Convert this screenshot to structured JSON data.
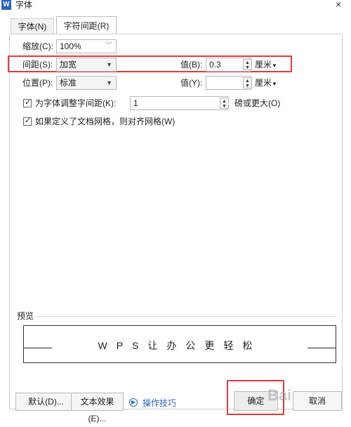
{
  "window": {
    "title": "字体",
    "app_icon": "W",
    "close_glyph": "×"
  },
  "tabs": [
    {
      "label": "字体(N)",
      "active": false
    },
    {
      "label": "字符间距(R)",
      "active": true
    }
  ],
  "form": {
    "scale_label": "缩放(C):",
    "scale_value": "100%",
    "spacing_label": "间距(S):",
    "spacing_value": "加宽",
    "spacing_amount_label": "值(B):",
    "spacing_amount_value": "0.3",
    "spacing_unit": "厘米",
    "position_label": "位置(P):",
    "position_value": "标准",
    "position_amount_label": "值(Y):",
    "position_amount_value": "",
    "position_unit": "厘米",
    "kerning_label": "为字体调整字间距(K):",
    "kerning_checked": true,
    "kerning_value": "1",
    "kerning_suffix": "磅或更大(O)",
    "grid_label": "如果定义了文档网格，则对齐网格(W)",
    "grid_checked": true
  },
  "preview": {
    "label": "预览",
    "sample_text": "WPS让办公更轻松"
  },
  "buttons": {
    "default": "默认(D)...",
    "text_effects": "文本效果(E)...",
    "tips": "操作技巧",
    "ok": "确定",
    "cancel": "取消"
  },
  "watermark_text": "Bai",
  "colors": {
    "highlight": "#e23a3a",
    "link": "#2b62c6"
  }
}
